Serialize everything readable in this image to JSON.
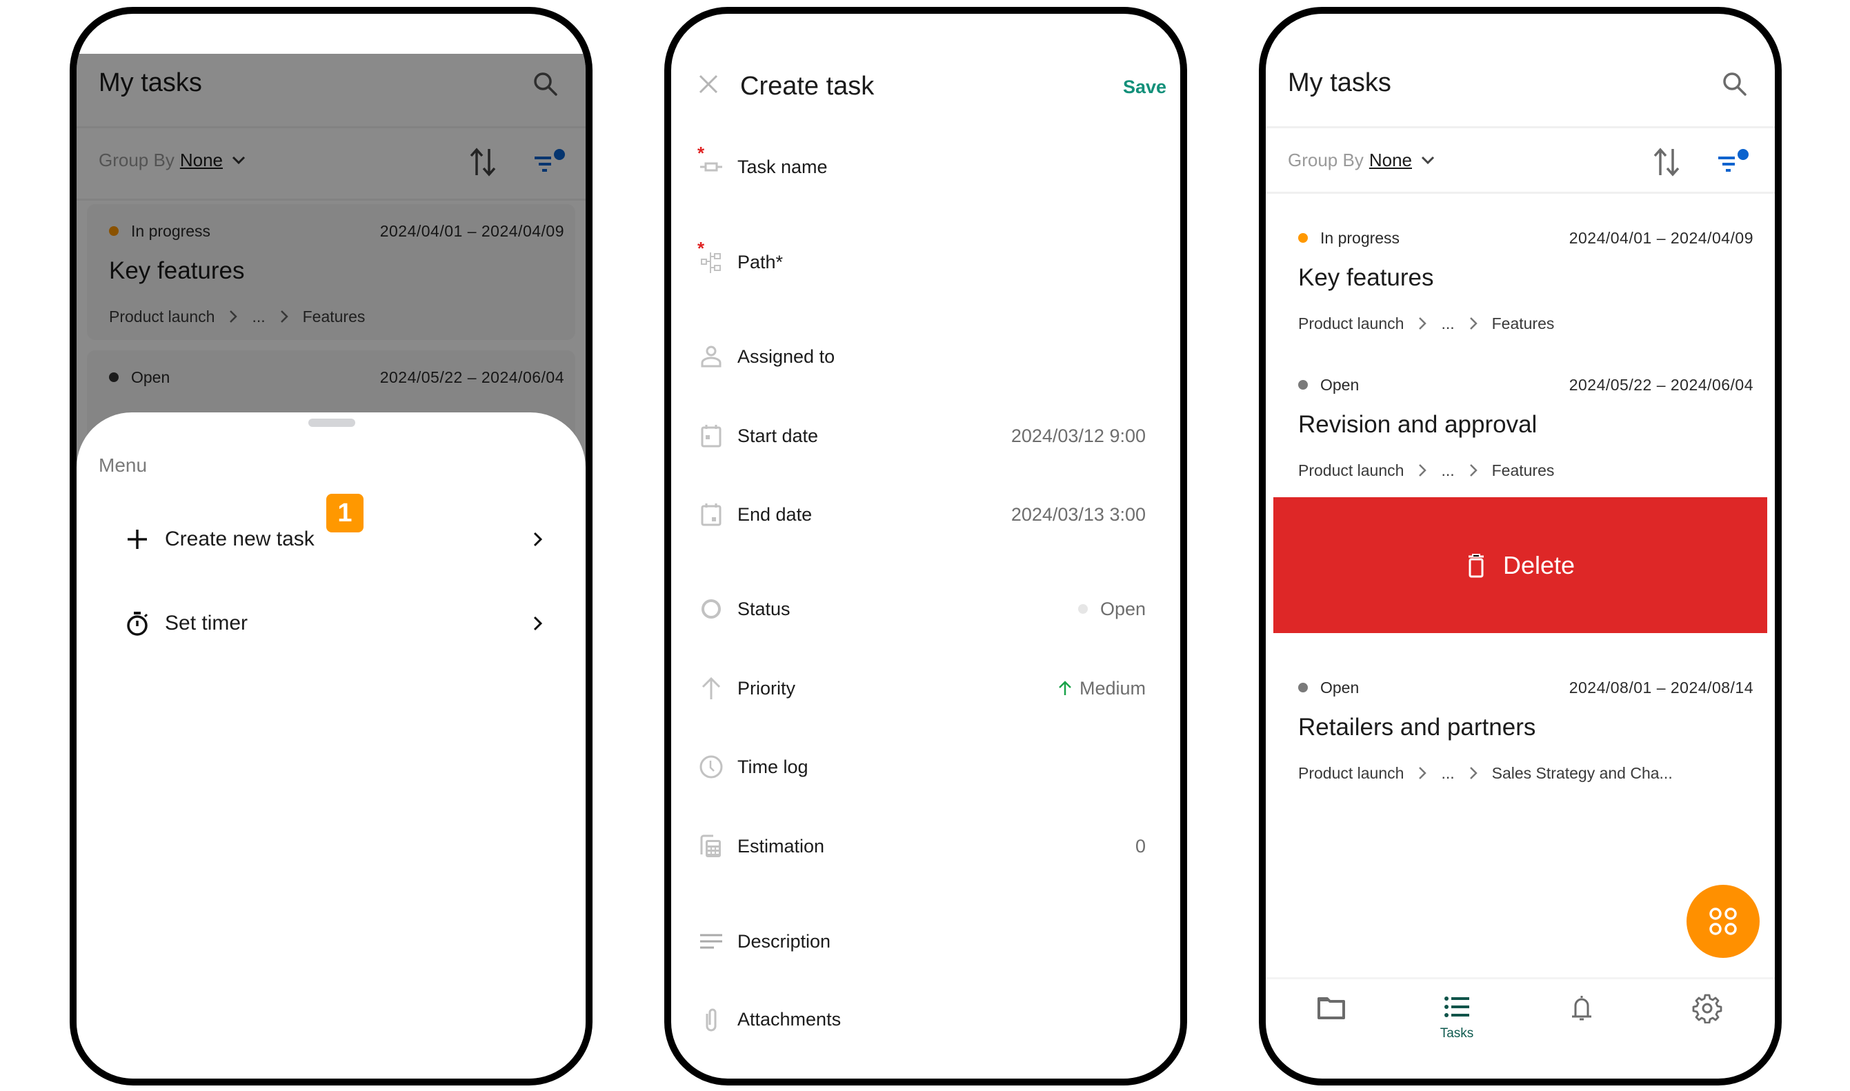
{
  "phone1": {
    "header": {
      "title": "My tasks",
      "search_icon": "search-icon"
    },
    "toolbar": {
      "group_by_label": "Group By",
      "group_by_value": "None",
      "sort_icon": "sort-icon",
      "filter_icon": "filter-icon"
    },
    "tasks": [
      {
        "status": "In progress",
        "status_color": "#c06a10",
        "dates": "2024/04/01 – 2024/04/09",
        "title": "Key features",
        "path": [
          "Product launch",
          "...",
          "Features"
        ]
      },
      {
        "status": "Open",
        "status_color": "#333333",
        "dates": "2024/05/22 – 2024/06/04"
      }
    ],
    "menu": {
      "label": "Menu",
      "items": [
        {
          "label": "Create new task",
          "icon": "plus-icon"
        },
        {
          "label": "Set timer",
          "icon": "stopwatch-icon"
        }
      ],
      "badge": "1"
    }
  },
  "phone2": {
    "header": {
      "title": "Create task",
      "save_label": "Save",
      "close_icon": "close-icon"
    },
    "fields": [
      {
        "label": "Task name",
        "required": true,
        "value": ""
      },
      {
        "label": "Path*",
        "required": true,
        "value": ""
      },
      {
        "label": "Assigned to",
        "required": false,
        "value": ""
      },
      {
        "label": "Start date",
        "required": false,
        "value": "2024/03/12 9:00"
      },
      {
        "label": "End date",
        "required": false,
        "value": "2024/03/13 3:00"
      },
      {
        "label": "Status",
        "required": false,
        "value": "Open"
      },
      {
        "label": "Priority",
        "required": false,
        "value": "Medium"
      },
      {
        "label": "Time log",
        "required": false,
        "value": ""
      },
      {
        "label": "Estimation",
        "required": false,
        "value": "0"
      },
      {
        "label": "Description",
        "required": false,
        "value": ""
      },
      {
        "label": "Attachments",
        "required": false,
        "value": ""
      }
    ],
    "colors": {
      "save": "#13907a",
      "required": "#e02424",
      "priority_medium": "#1aa34a"
    }
  },
  "phone3": {
    "header": {
      "title": "My tasks"
    },
    "toolbar": {
      "group_by_label": "Group By",
      "group_by_value": "None"
    },
    "tasks": [
      {
        "status": "In progress",
        "status_color": "#ff9800",
        "dates": "2024/04/01 – 2024/04/09",
        "title": "Key features",
        "path": [
          "Product launch",
          "...",
          "Features"
        ]
      },
      {
        "status": "Open",
        "status_color": "#7a7a7a",
        "dates": "2024/05/22 – 2024/06/04",
        "title": "Revision and approval",
        "path": [
          "Product launch",
          "...",
          "Features"
        ]
      },
      {
        "status": "Open",
        "status_color": "#7a7a7a",
        "dates": "2024/08/01 – 2024/08/14",
        "title": "Retailers and partners",
        "path": [
          "Product launch",
          "...",
          "Sales Strategy and Cha..."
        ]
      }
    ],
    "swipe_action": {
      "label": "Delete",
      "color": "#de2727"
    },
    "bottom_nav": [
      {
        "name": "projects",
        "icon": "folder-icon",
        "label": ""
      },
      {
        "name": "tasks",
        "icon": "task-list-icon",
        "label": "Tasks",
        "active": true
      },
      {
        "name": "notifications",
        "icon": "bell-icon",
        "label": ""
      },
      {
        "name": "settings",
        "icon": "gear-icon",
        "label": ""
      }
    ],
    "fab_color": "#ff9000"
  }
}
